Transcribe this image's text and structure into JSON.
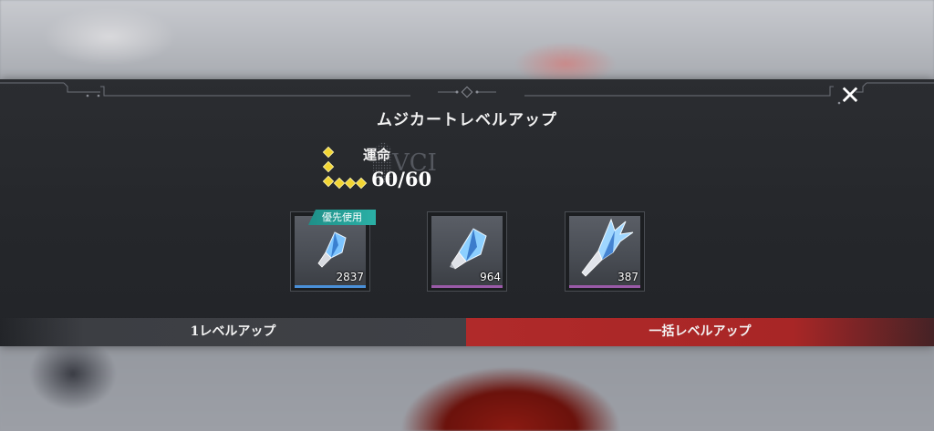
{
  "dialog": {
    "title": "ムジカートレベルアップ",
    "close_icon": "close-icon"
  },
  "fate": {
    "label": "運命",
    "value": "60/60",
    "stars": 6,
    "star_color": "#f2d533"
  },
  "materials": [
    {
      "icon": "small-crystal-icon",
      "count": "2837",
      "bar_color": "#4a90d9",
      "priority": true
    },
    {
      "icon": "medium-crystal-icon",
      "count": "964",
      "bar_color": "#9a5aa8",
      "priority": false
    },
    {
      "icon": "large-crystal-icon",
      "count": "387",
      "bar_color": "#9a5aa8",
      "priority": false
    }
  ],
  "priority_badge": "優先使用",
  "buttons": {
    "single": "1レベルアップ",
    "bulk": "一括レベルアップ"
  },
  "colors": {
    "panel": "#27292d",
    "bulk_button": "#a82626",
    "badge": "#26a097"
  }
}
